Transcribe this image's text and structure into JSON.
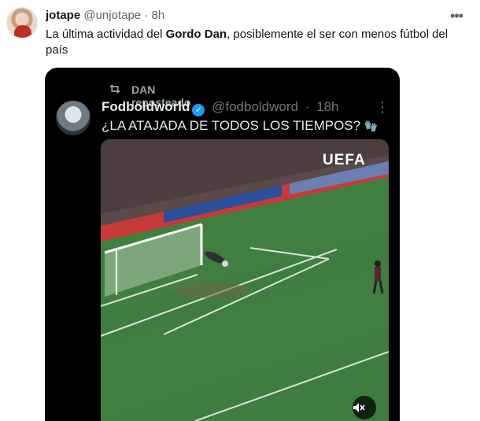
{
  "tweet": {
    "author_name": "jotape",
    "author_handle": "@unjotape",
    "separator": "·",
    "time": "8h",
    "more_icon": "more-icon",
    "text_before": "La última actividad del ",
    "text_bold": "Gordo Dan",
    "text_after": ", posiblemente el ser con menos fútbol del país"
  },
  "quoted": {
    "repost_label": "DAN reposteado",
    "author_name": "Fodboldworld",
    "author_handle": "@fodboldword",
    "separator": "·",
    "time": "18h",
    "text": "¿LA ATAJADA DE TODOS LOS TIEMPOS?",
    "video_watermark": "UEFA",
    "verified_color": "#1d9bf0"
  }
}
